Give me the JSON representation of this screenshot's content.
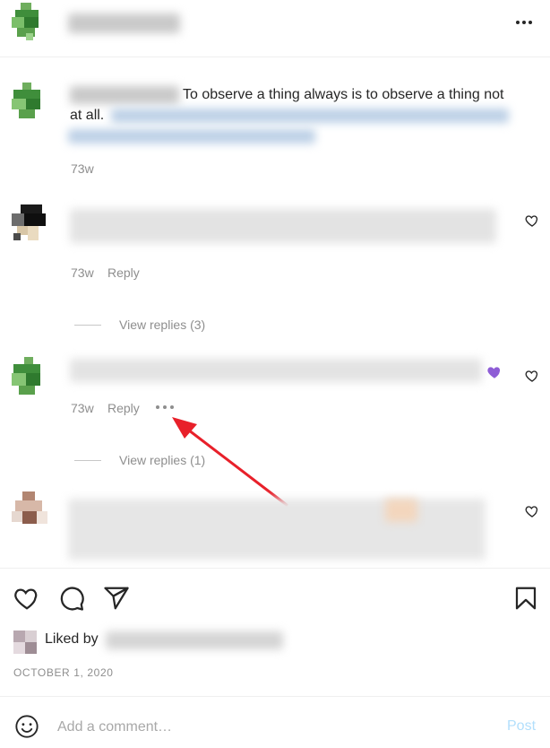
{
  "post": {
    "caption_text_1": "To observe a thing always is to observe a thing not",
    "caption_text_2": "at all.",
    "caption_time": "73w"
  },
  "comments": [
    {
      "time": "73w",
      "reply_label": "Reply",
      "view_replies": "",
      "liked": false
    },
    {
      "time": "73w",
      "reply_label": "Reply",
      "view_replies": "View replies (3)",
      "liked": false
    },
    {
      "time": "73w",
      "reply_label": "Reply",
      "view_replies": "View replies (1)",
      "liked": true
    }
  ],
  "thread": {
    "view_replies_1": "View replies (3)",
    "view_replies_2": "View replies (1)"
  },
  "likes": {
    "liked_by_label": "Liked by",
    "date": "OCTOBER 1, 2020"
  },
  "composer": {
    "placeholder": "Add a comment…",
    "post_label": "Post"
  },
  "colors": {
    "liked_heart": "#8e5dd6",
    "annotation_arrow": "#e8202a",
    "link_blue": "#00376b"
  },
  "icons": [
    "more-icon",
    "heart-icon",
    "comment-icon",
    "share-icon",
    "bookmark-icon",
    "emoji-icon"
  ]
}
